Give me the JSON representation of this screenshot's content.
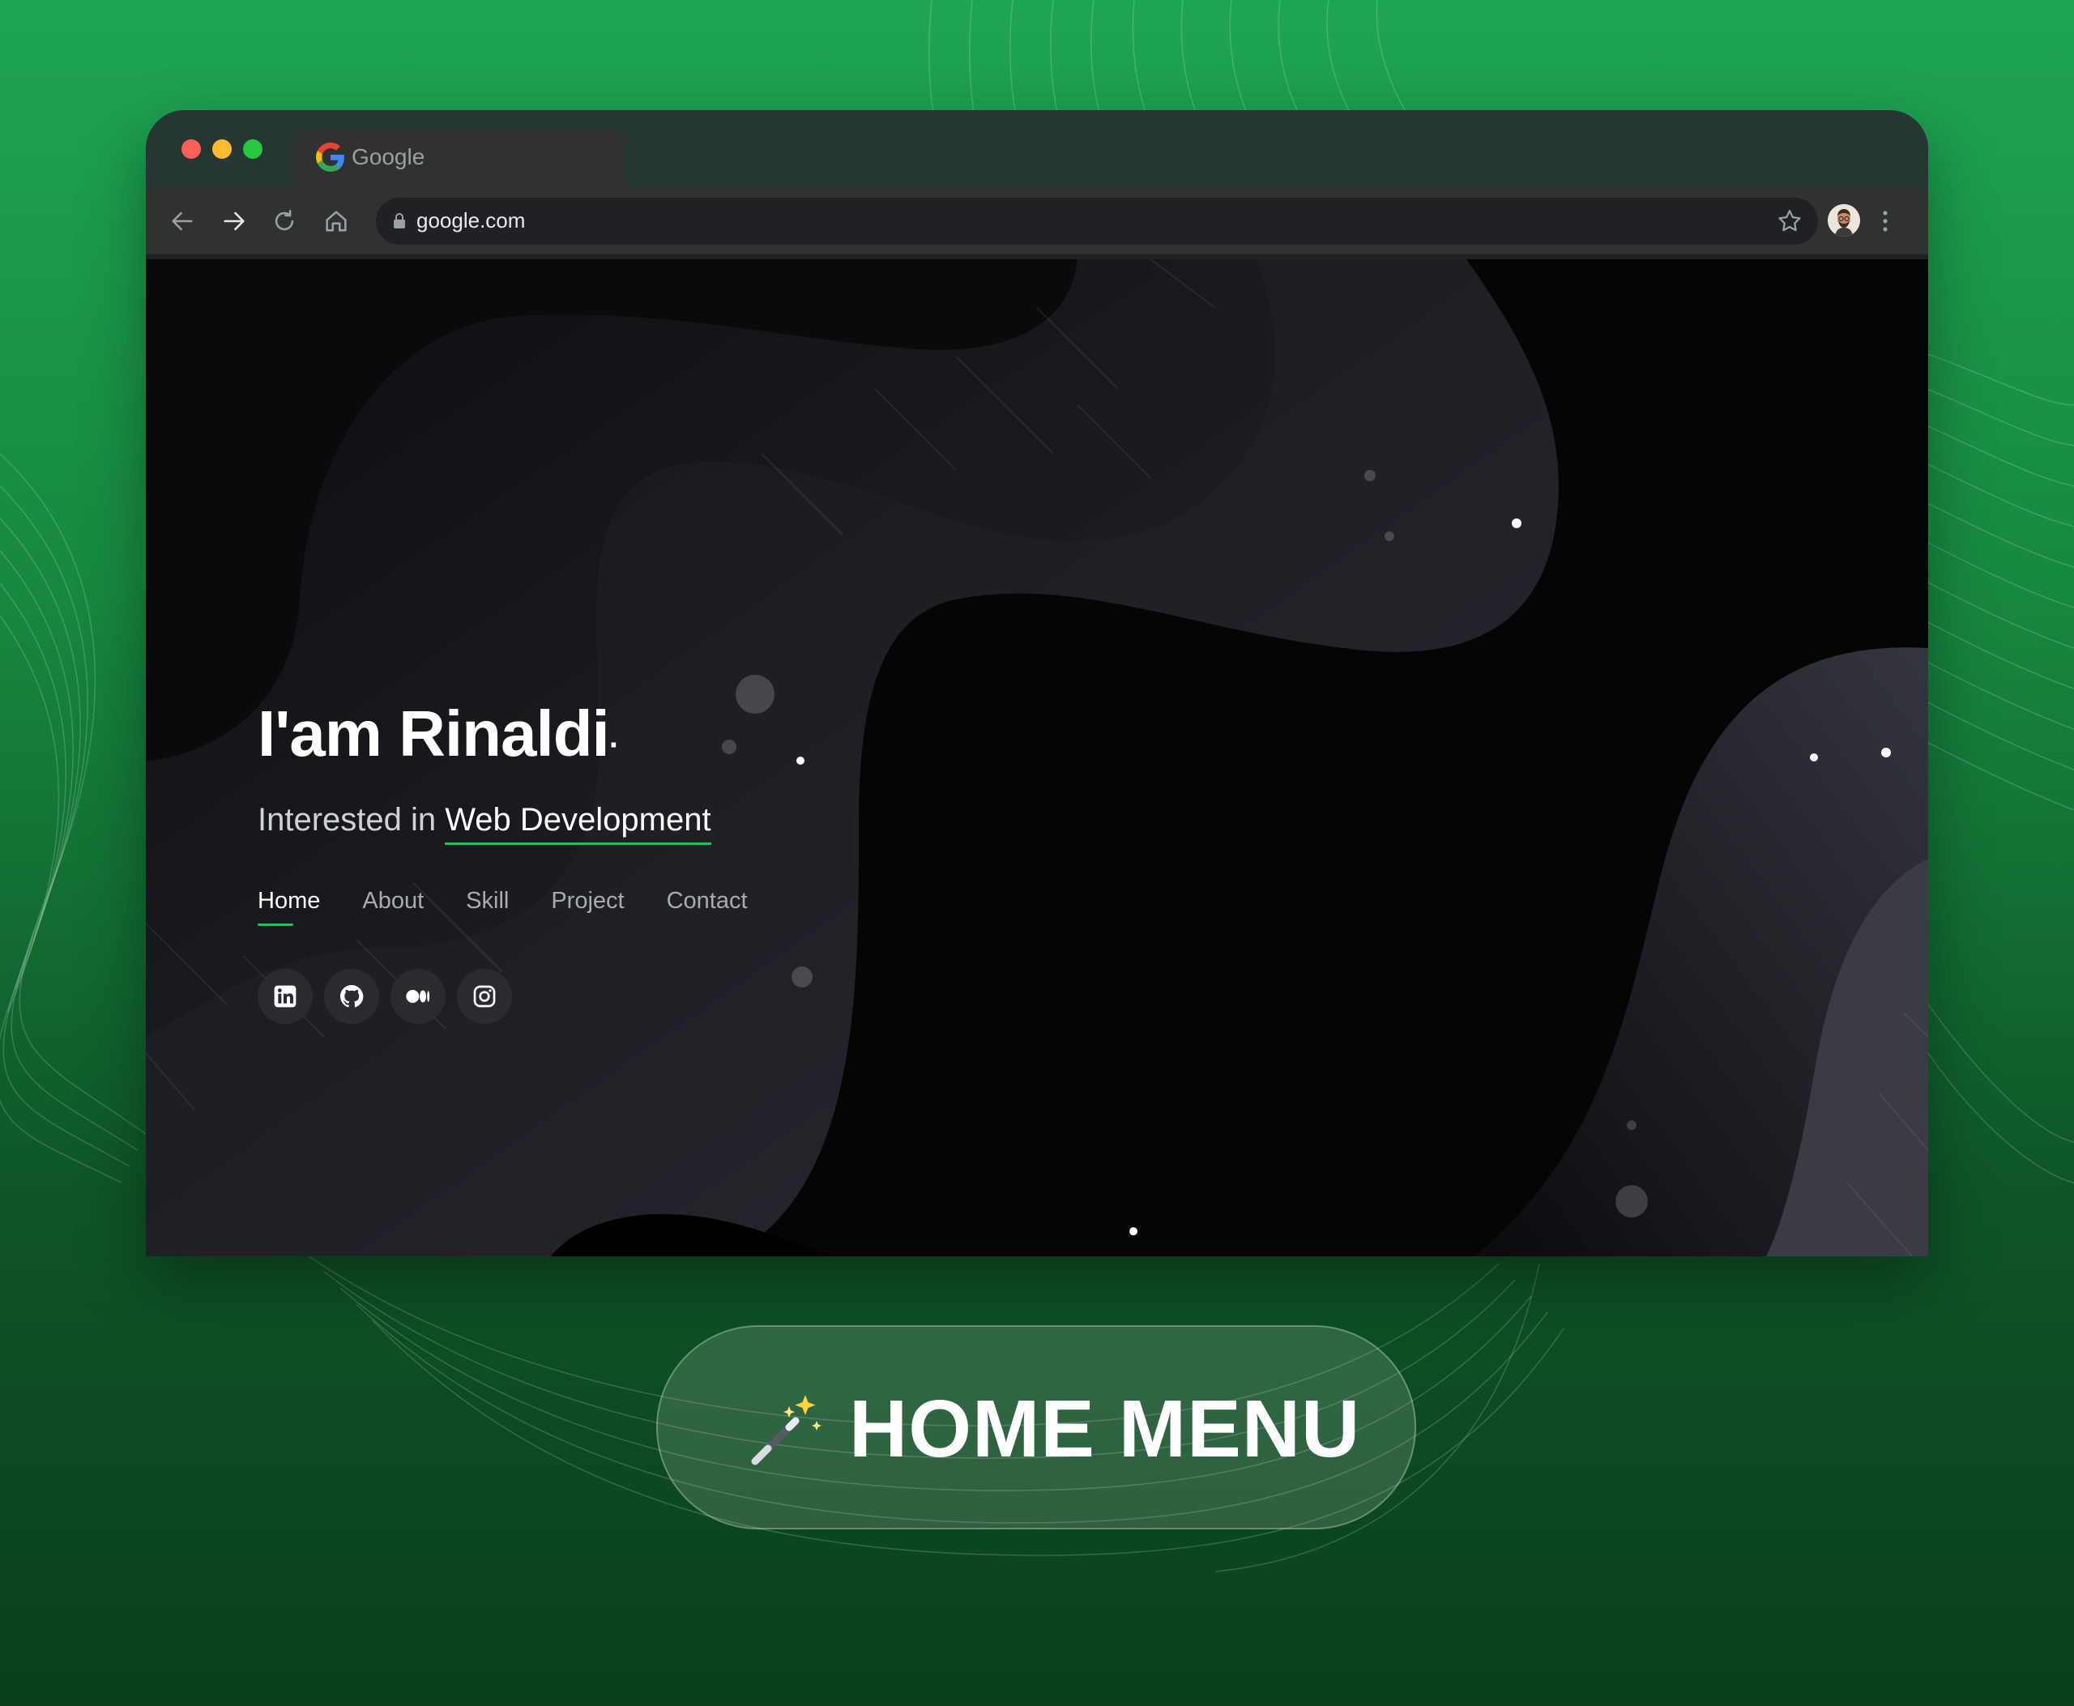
{
  "browser": {
    "tab_title": "Google",
    "url": "google.com"
  },
  "hero": {
    "title": "I'am Rinaldi",
    "title_suffix": "·",
    "subtitle_prefix": "Interested in ",
    "subtitle_highlight": "Web Development",
    "nav": [
      {
        "label": "Home",
        "active": true
      },
      {
        "label": "About",
        "active": false
      },
      {
        "label": "Skill",
        "active": false
      },
      {
        "label": "Project",
        "active": false
      },
      {
        "label": "Contact",
        "active": false
      }
    ],
    "socials": [
      "linkedin-icon",
      "github-icon",
      "medium-icon",
      "instagram-icon"
    ]
  },
  "badge": {
    "icon": "magic-wand-icon",
    "label": "HOME MENU"
  },
  "colors": {
    "background_green": "#1ea553",
    "accent": "#1fbf62",
    "browser_chrome": "#253633"
  }
}
